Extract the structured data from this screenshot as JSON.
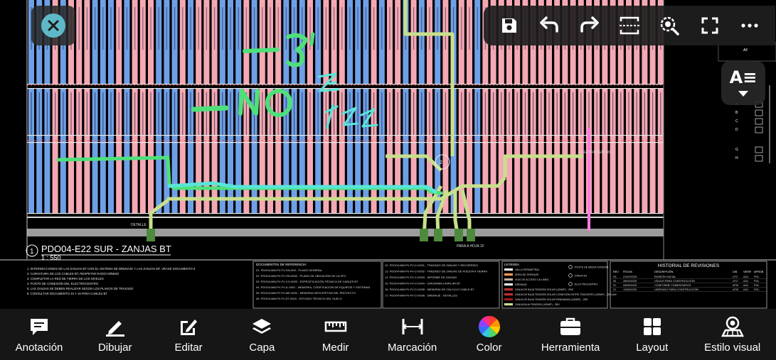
{
  "drawing": {
    "view_title": "PDO04-E22 SUR - ZANJAS BT",
    "view_number": "1",
    "scale": "1 : 550",
    "handwriting": [
      "-5\"",
      "-NO",
      "ZE",
      "EZZ"
    ],
    "revisions_title": "HISTORIAL DE REVISIONES",
    "rev_headers": [
      "REV",
      "FECHA",
      "DESCRIPCIÓN",
      "DIB",
      "VERIF",
      "APROB"
    ],
    "rev_rows": [
      [
        "0A",
        "21/02/2025",
        "EMISIÓN INICIAL",
        "LFO",
        "AJU",
        "PGL"
      ],
      [
        "00",
        "28/03/2025",
        "VÁLIDO PARA CONSTRUCCIÓN",
        "LFO",
        "AJU",
        "PGL"
      ],
      [
        "01",
        "09/05/2025",
        "CONFORME COMENTARIOS",
        "AFM",
        "AJU",
        "PGL"
      ],
      [
        "01",
        "13/06/2025",
        "LIBERADO PARA CONSTRUCCIÓN",
        "AFM",
        "AJU",
        "PGL"
      ]
    ],
    "legend_title": "LEYENDA",
    "legend_items": [
      "VALLA PERIMETRAL",
      "ÁREA DE DRENAJE",
      "VIAS DE ACCESO CA LINEA",
      "DRENAJE",
      "ZANJA DE BAJA TENSIÓN SOLAR (100MP) - ZBS",
      "ZANJA DE BAJA TENSIÓN SOLAR CONEXIÓN ENTRE TRACKERS (100MP) - ZBS-AM",
      "ZANJA DE BAJA TENSIÓN SOLAR REBANADA (150MP) - ZBS",
      "ZANJA BAJA TENSIÓN (100MP) - ZBX"
    ],
    "legend_symbols": [
      "POSTE DE MEDIA TENSIÓN",
      "ZANJA 3/3",
      "ELECTROCENTRO"
    ],
    "references_title": "DOCUMENTOS DE REFERENCIA:",
    "references": [
      "01. PDO04-MM-PV-FV-GN-000 - PLANO GENERAL",
      "02. PDO04-MM-PV-FV-GN-0002 - PLANO DE UBICACIÓN DE LA SFV",
      "03. PDO04-MM-PV-FV-CO-0003 - ESPECIFICACIÓN TÉCNICA DE CABLES BT",
      "04. PDO04-MM-PV-FV-IL-0001 - MEMORIA, CODIFICACIÓN DE EQUIPOS Y SISTEMAS",
      "05. PDO04-MM-PV-FV-ME-0002 - MEMORIA DESCRIPTIVA DEL PROYECTO",
      "06. PDO04-MM-PV-FV-ST-0003 - ESTUDIO TÉCNICO DEL SUELO"
    ],
    "references_2": [
      "12. PDO04-MM-PV-FV-CI-0001 - TRAZADO DE ZANJAS Y RECORRIDO",
      "13. PDO04-MM-PV-FV-CI-0002 - TRAZADO DE ZANJAS DE PUESTA A TIERRA",
      "14. PDO04-MM-PV-FV-CI-0003 - INFORME DE ZANJAS",
      "15. PDO04-MM-PV-FV-CI-0004 - DIAGRAMA UNIFILAR BT",
      "16. PDO04-MM-PV-FV-CI-0005 - MEMORIA DE CÁLCULO CABLE BT",
      "17. PDO04-MM-PV-FV-CI-0006 - DRENAJE - DETALLES"
    ],
    "notes": [
      "1. INTERSECCIONES DE LAS ZANJAS BT CON EL SISTEMA DE DRENAJE Y LAS ZANJAS MT. VÉASE DOCUMENTO 6",
      "2. CURVATURA DE LOS CABLES BT, RESPETAR RADIO MÍNIMO",
      "3. COMPLETAR LA RED DE TIERRA DE LOS NIVELES",
      "4. PUNTO DE CONEXIÓN DEL ELECTROCENTRO",
      "5. LAS ZANJAS SE DEBEN REALIZAR SEGÚN LOS PLANOS DE TRAZADO",
      "6. CONSULTAR DOCUMENTO 10 Y 16 PARA CABLES BT"
    ],
    "annotations": [
      "DETALLE",
      "PARA A HOJA 1F",
      "ELECTROCENTRO"
    ],
    "legend_right": [
      "A",
      "B",
      "C",
      "D",
      "G",
      "H"
    ]
  },
  "toolbar": {
    "close": "close-icon",
    "items": [
      {
        "name": "save-icon"
      },
      {
        "name": "undo-icon"
      },
      {
        "name": "redo-icon"
      },
      {
        "name": "crop-icon"
      },
      {
        "name": "zoom-icon"
      },
      {
        "name": "fullscreen-icon"
      },
      {
        "name": "more-icon"
      }
    ]
  },
  "text_style_button": {
    "glyph": "A≡"
  },
  "bottom_bar": [
    {
      "label": "Anotación",
      "icon": "comment-icon"
    },
    {
      "label": "Dibujar",
      "icon": "pencil-icon"
    },
    {
      "label": "Editar",
      "icon": "edit-icon"
    },
    {
      "label": "Capa",
      "icon": "layers-icon"
    },
    {
      "label": "Medir",
      "icon": "ruler-icon"
    },
    {
      "label": "Marcación",
      "icon": "marking-icon"
    },
    {
      "label": "Color",
      "icon": "color-wheel-icon"
    },
    {
      "label": "Herramienta",
      "icon": "toolbox-icon"
    },
    {
      "label": "Layout",
      "icon": "layout-icon"
    },
    {
      "label": "Estilo visual",
      "icon": "visual-style-icon"
    }
  ],
  "colors": {
    "pink": "#f4a8b4",
    "blue": "#6f9fe6",
    "hand_green": "#4ee07a",
    "hand_cyan": "#58e6d8",
    "trench_green": "#c8e08c",
    "accent": "#5fb8c7"
  }
}
